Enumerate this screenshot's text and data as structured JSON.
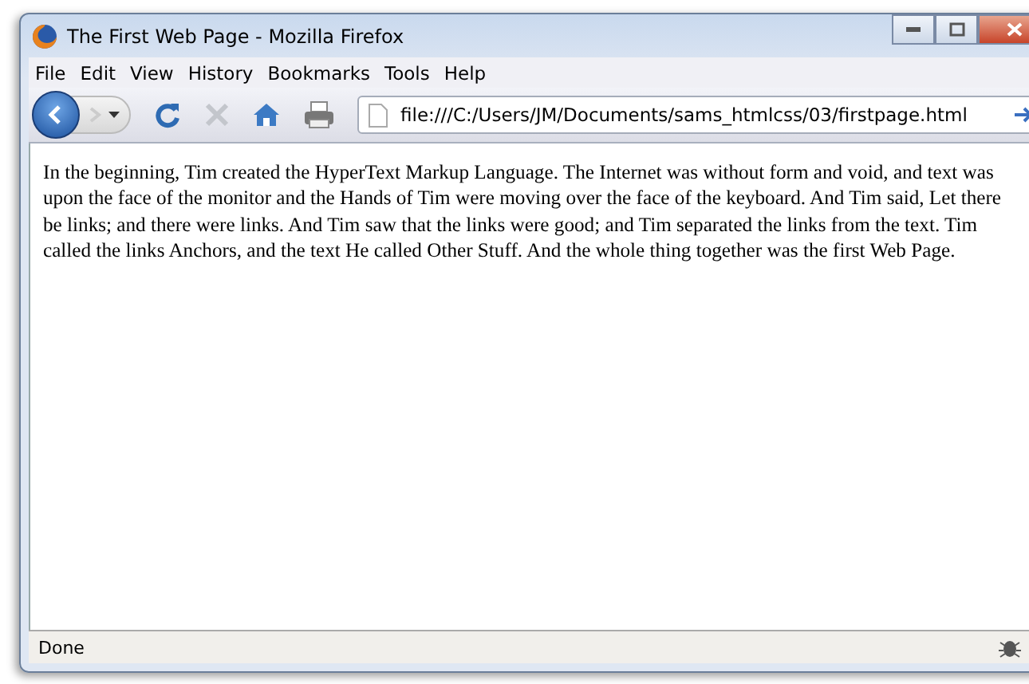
{
  "window": {
    "title": "The First Web Page - Mozilla Firefox"
  },
  "menu": [
    "File",
    "Edit",
    "View",
    "History",
    "Bookmarks",
    "Tools",
    "Help"
  ],
  "address_bar": {
    "value": "file:///C:/Users/JM/Documents/sams_htmlcss/03/firstpage.html"
  },
  "page": {
    "paragraph": "In the beginning, Tim created the HyperText Markup Language. The Internet was without form and void, and text was upon the face of the monitor and the Hands of Tim were moving over the face of the keyboard. And Tim said, Let there be links; and there were links. And Tim saw that the links were good; and Tim separated the links from the text. Tim called the links Anchors, and the text He called Other Stuff. And the whole thing together was the first Web Page."
  },
  "status_bar": {
    "text": "Done"
  }
}
